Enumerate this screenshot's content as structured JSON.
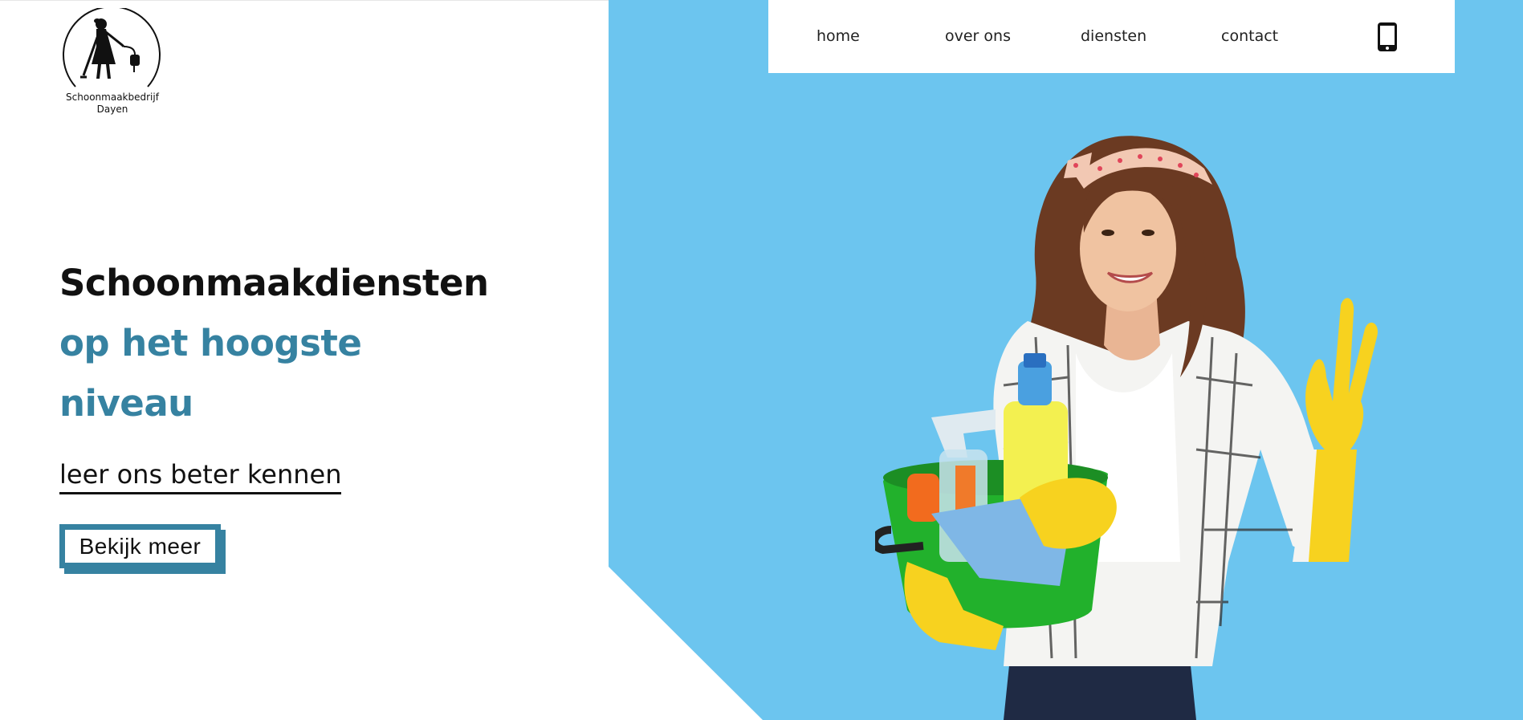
{
  "brand": {
    "name_line1": "Schoonmaakbedrijf",
    "name_line2": "Dayen",
    "logo_icon": "cleaning-lady-silhouette"
  },
  "nav": {
    "items": [
      {
        "label": "home"
      },
      {
        "label": "over ons"
      },
      {
        "label": "diensten"
      },
      {
        "label": "contact"
      }
    ],
    "phone_icon": "mobile-phone-icon"
  },
  "hero": {
    "title_line1": "Schoonmaakdiensten",
    "title_line2": "op het hoogste",
    "title_line3": "niveau",
    "link_label": "leer ons beter kennen",
    "button_label": "Bekijk meer"
  },
  "colors": {
    "accent": "#3682a1",
    "panel": "#6cc5ef",
    "text": "#111111"
  }
}
